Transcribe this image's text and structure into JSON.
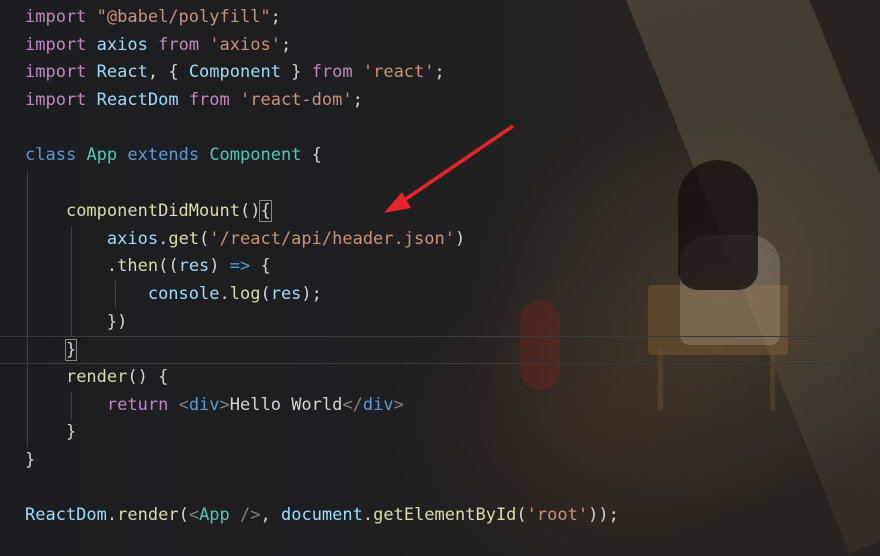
{
  "editor": {
    "lines": [
      {
        "t": [
          [
            "import",
            "kw2"
          ],
          [
            " ",
            "pl"
          ],
          [
            "\"@babel/polyfill\"",
            "str"
          ],
          [
            ";",
            "pl"
          ]
        ]
      },
      {
        "t": [
          [
            "import",
            "kw2"
          ],
          [
            " ",
            "pl"
          ],
          [
            "axios",
            "var"
          ],
          [
            " ",
            "pl"
          ],
          [
            "from",
            "kw2"
          ],
          [
            " ",
            "pl"
          ],
          [
            "'axios'",
            "str"
          ],
          [
            ";",
            "pl"
          ]
        ]
      },
      {
        "t": [
          [
            "import",
            "kw2"
          ],
          [
            " ",
            "pl"
          ],
          [
            "React",
            "var"
          ],
          [
            ", { ",
            "pl"
          ],
          [
            "Component",
            "var"
          ],
          [
            " } ",
            "pl"
          ],
          [
            "from",
            "kw2"
          ],
          [
            " ",
            "pl"
          ],
          [
            "'react'",
            "str"
          ],
          [
            ";",
            "pl"
          ]
        ]
      },
      {
        "t": [
          [
            "import",
            "kw2"
          ],
          [
            " ",
            "pl"
          ],
          [
            "ReactDom",
            "var"
          ],
          [
            " ",
            "pl"
          ],
          [
            "from",
            "kw2"
          ],
          [
            " ",
            "pl"
          ],
          [
            "'react-dom'",
            "str"
          ],
          [
            ";",
            "pl"
          ]
        ]
      },
      {
        "t": []
      },
      {
        "t": [
          [
            "class",
            "kw"
          ],
          [
            " ",
            "pl"
          ],
          [
            "App",
            "cls"
          ],
          [
            " ",
            "pl"
          ],
          [
            "extends",
            "kw"
          ],
          [
            " ",
            "pl"
          ],
          [
            "Component",
            "cls"
          ],
          [
            " {",
            "pl"
          ]
        ]
      },
      {
        "t": [],
        "guides": [
          1
        ]
      },
      {
        "t": [
          [
            "    ",
            "pl"
          ],
          [
            "componentDidMount",
            "fn"
          ],
          [
            "()",
            "pl"
          ],
          [
            "{",
            "pl",
            "box"
          ]
        ],
        "guides": [
          1
        ]
      },
      {
        "t": [
          [
            "        ",
            "pl"
          ],
          [
            "axios",
            "var"
          ],
          [
            ".",
            "pl"
          ],
          [
            "get",
            "fn"
          ],
          [
            "(",
            "pl"
          ],
          [
            "'/react/api/header.json'",
            "str"
          ],
          [
            ")",
            "pl"
          ]
        ],
        "guides": [
          1,
          2
        ]
      },
      {
        "t": [
          [
            "        ",
            "pl"
          ],
          [
            ".",
            "pl"
          ],
          [
            "then",
            "fn"
          ],
          [
            "((",
            "pl"
          ],
          [
            "res",
            "var"
          ],
          [
            ") ",
            "pl"
          ],
          [
            "=>",
            "kw"
          ],
          [
            " {",
            "pl"
          ]
        ],
        "guides": [
          1,
          2
        ]
      },
      {
        "t": [
          [
            "            ",
            "pl"
          ],
          [
            "console",
            "var"
          ],
          [
            ".",
            "pl"
          ],
          [
            "log",
            "fn"
          ],
          [
            "(",
            "pl"
          ],
          [
            "res",
            "var"
          ],
          [
            ");",
            "pl"
          ]
        ],
        "guides": [
          1,
          2,
          3
        ]
      },
      {
        "t": [
          [
            "        ",
            "pl"
          ],
          [
            "})",
            "pl"
          ]
        ],
        "guides": [
          1,
          2
        ]
      },
      {
        "t": [
          [
            "    ",
            "pl"
          ],
          [
            "}",
            "pl",
            "box"
          ]
        ],
        "guides": [
          1
        ],
        "current": true
      },
      {
        "t": [
          [
            "    ",
            "pl"
          ],
          [
            "render",
            "fn"
          ],
          [
            "() {",
            "pl"
          ]
        ],
        "guides": [
          1
        ]
      },
      {
        "t": [
          [
            "        ",
            "pl"
          ],
          [
            "return",
            "kw2"
          ],
          [
            " ",
            "pl"
          ],
          [
            "<",
            "tag"
          ],
          [
            "div",
            "tagn"
          ],
          [
            ">",
            "tag"
          ],
          [
            "Hello World",
            "pl"
          ],
          [
            "</",
            "tag"
          ],
          [
            "div",
            "tagn"
          ],
          [
            ">",
            "tag"
          ]
        ],
        "guides": [
          1,
          2
        ]
      },
      {
        "t": [
          [
            "    ",
            "pl"
          ],
          [
            "}",
            "pl"
          ]
        ],
        "guides": [
          1
        ]
      },
      {
        "t": [
          [
            "}",
            "pl"
          ]
        ]
      },
      {
        "t": []
      },
      {
        "t": [
          [
            "ReactDom",
            "var"
          ],
          [
            ".",
            "pl"
          ],
          [
            "render",
            "fn"
          ],
          [
            "(",
            "pl"
          ],
          [
            "<",
            "tag"
          ],
          [
            "App",
            "cls"
          ],
          [
            " />",
            "tag"
          ],
          [
            ", ",
            "pl"
          ],
          [
            "document",
            "var"
          ],
          [
            ".",
            "pl"
          ],
          [
            "getElementById",
            "fn"
          ],
          [
            "(",
            "pl"
          ],
          [
            "'root'",
            "str"
          ],
          [
            "));",
            "pl"
          ]
        ]
      }
    ]
  },
  "annotation": {
    "arrow_color": "#e8242b"
  },
  "background": {
    "beam_color": "#e6c896"
  }
}
